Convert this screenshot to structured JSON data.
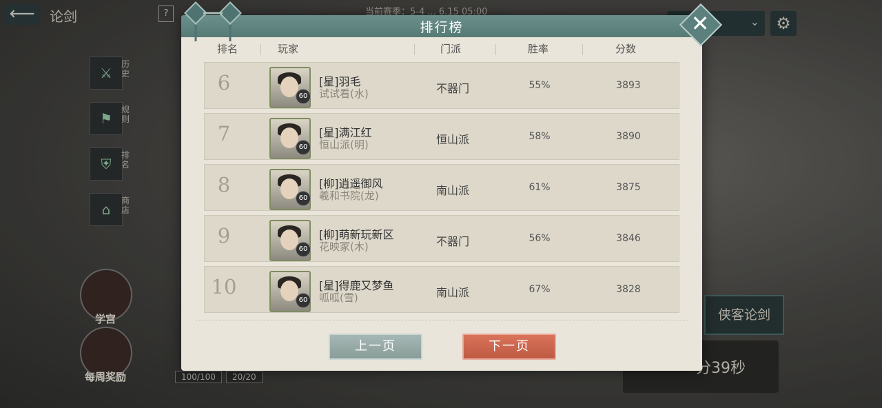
{
  "background": {
    "title": "论剑",
    "help_label": "?",
    "season_text": "当前赛季：5-4 ... 6.15 05:00",
    "side_buttons": [
      {
        "label": "历史",
        "icon": "crossed-swords-icon"
      },
      {
        "label": "规则",
        "icon": "flag-icon"
      },
      {
        "label": "排名",
        "icon": "shield-badge-icon"
      },
      {
        "label": "商店",
        "icon": "shop-icon"
      }
    ],
    "round_buttons": [
      {
        "label": "学宫",
        "icon": "palace-icon"
      },
      {
        "label": "每周奖励",
        "icon": "treasure-chest-icon"
      }
    ],
    "counters": [
      "100/100",
      "20/20"
    ],
    "right_tab": "侠客论剑",
    "timer": "分39秒"
  },
  "modal": {
    "title": "排行榜",
    "columns": {
      "rank": "排名",
      "player": "玩家",
      "faction": "门派",
      "winrate": "胜率",
      "score": "分数"
    },
    "rows": [
      {
        "rank": "6",
        "name": "[星]羽毛",
        "server": "试试看(水)",
        "level": "60",
        "faction": "不器门",
        "winrate": "55%",
        "score": "3893"
      },
      {
        "rank": "7",
        "name": "[星]满江红",
        "server": "恒山派(明)",
        "level": "60",
        "faction": "恒山派",
        "winrate": "58%",
        "score": "3890"
      },
      {
        "rank": "8",
        "name": "[柳]逍遥御风",
        "server": "羲和书院(龙)",
        "level": "60",
        "faction": "南山派",
        "winrate": "61%",
        "score": "3875"
      },
      {
        "rank": "9",
        "name": "[柳]萌新玩新区",
        "server": "花映冢(木)",
        "level": "60",
        "faction": "不器门",
        "winrate": "56%",
        "score": "3846"
      },
      {
        "rank": "10",
        "name": "[星]得鹿又梦鱼",
        "server": "呱呱(雪)",
        "level": "60",
        "faction": "南山派",
        "winrate": "67%",
        "score": "3828"
      }
    ],
    "prev_label": "上一页",
    "next_label": "下一页",
    "close_label": "✕"
  },
  "colors": {
    "header": "#5f8480",
    "next_button": "#c9624a",
    "prev_button": "#98aba7",
    "panel": "#e9e5da"
  }
}
